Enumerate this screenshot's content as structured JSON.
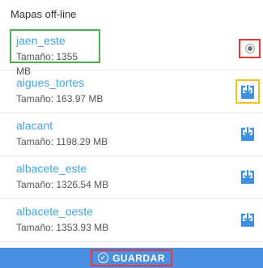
{
  "header": {
    "title": "Mapas off-line"
  },
  "maps": [
    {
      "name": "jaen_este",
      "size": "Tamaño: 1355 MB",
      "state": "selected"
    },
    {
      "name": "aigues_tortes",
      "size": "Tamaño: 163.97 MB",
      "state": "download"
    },
    {
      "name": "alacant",
      "size": "Tamaño: 1198.29 MB",
      "state": "download"
    },
    {
      "name": "albacete_este",
      "size": "Tamaño: 1326.54 MB",
      "state": "download"
    },
    {
      "name": "albacete_oeste",
      "size": "Tamaño: 1353.93 MB",
      "state": "download"
    }
  ],
  "footer": {
    "save_label": "GUARDAR"
  },
  "colors": {
    "accent": "#3fa7d6",
    "footer_bg": "#4a90e2",
    "download_icon": "#3d8fe0",
    "highlight_green": "#4caf50",
    "highlight_red": "#e53935",
    "highlight_yellow": "#f2c21b"
  },
  "icons": {
    "radio": "radio-selected-icon",
    "download": "download-icon",
    "save": "check-circle-icon"
  }
}
